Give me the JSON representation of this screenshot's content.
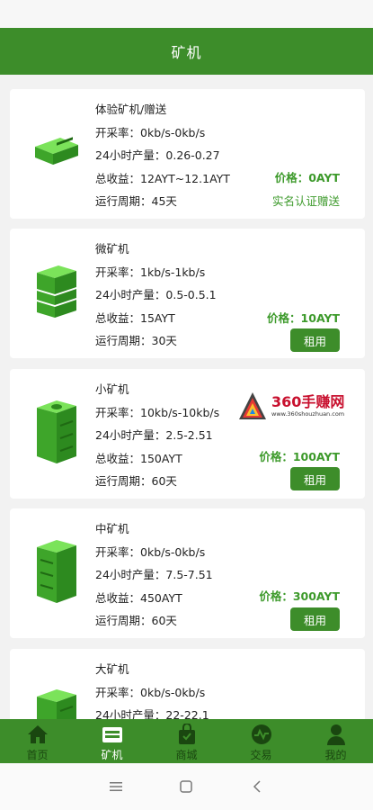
{
  "appbar": {
    "title": "矿机"
  },
  "machines": [
    {
      "name": "体验矿机/赠送",
      "rate": "开采率：0kb/s-0kb/s",
      "output": "24小时产量：0.26-0.27",
      "income": "总收益：12AYT~12.1AYT",
      "cycle": "运行周期：45天",
      "price": "价格：0AYT",
      "note": "实名认证赠送",
      "icon": "mining-machine-icon"
    },
    {
      "name": "微矿机",
      "rate": "开采率：1kb/s-1kb/s",
      "output": "24小时产量：0.5-0.5.1",
      "income": "总收益：15AYT",
      "cycle": "运行周期：30天",
      "price": "价格：10AYT",
      "button": "租用",
      "icon": "mining-machine-icon"
    },
    {
      "name": "小矿机",
      "rate": "开采率：10kb/s-10kb/s",
      "output": "24小时产量：2.5-2.51",
      "income": "总收益：150AYT",
      "cycle": "运行周期：60天",
      "price": "价格：100AYT",
      "button": "租用",
      "icon": "mining-machine-icon"
    },
    {
      "name": "中矿机",
      "rate": "开采率：0kb/s-0kb/s",
      "output": "24小时产量：7.5-7.51",
      "income": "总收益：450AYT",
      "cycle": "运行周期：60天",
      "price": "价格：300AYT",
      "button": "租用",
      "icon": "mining-machine-icon"
    },
    {
      "name": "大矿机",
      "rate": "开采率：0kb/s-0kb/s",
      "output": "24小时产量：22-22.1",
      "icon": "mining-machine-icon"
    }
  ],
  "watermark": {
    "title": "360手赚网",
    "url": "www.360shouzhuan.com"
  },
  "tabs": [
    {
      "label": "首页",
      "icon": "home-icon"
    },
    {
      "label": "矿机",
      "icon": "miner-icon",
      "active": true
    },
    {
      "label": "商城",
      "icon": "shopping-bag-icon"
    },
    {
      "label": "交易",
      "icon": "trade-icon"
    },
    {
      "label": "我的",
      "icon": "user-icon"
    }
  ],
  "colors": {
    "primary": "#3d8d2a",
    "price": "#3d9a2b",
    "background": "#f2f2f2"
  }
}
